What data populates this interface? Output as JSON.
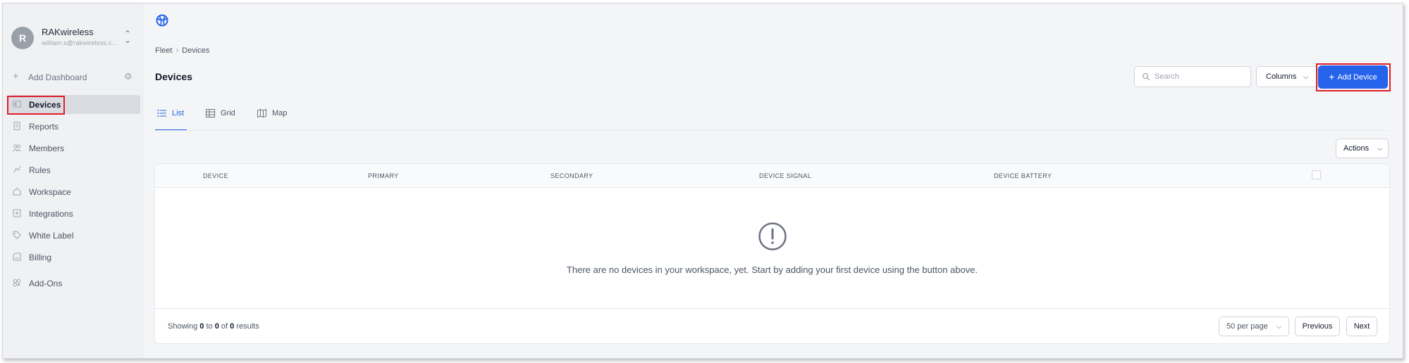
{
  "workspace": {
    "avatar_letter": "R",
    "name": "RAKwireless",
    "email": "william.s@rakwireless.com"
  },
  "sidebar": {
    "add_dashboard": "Add Dashboard",
    "items": [
      {
        "label": "Devices",
        "icon": "devices-icon",
        "active": true
      },
      {
        "label": "Reports",
        "icon": "report-icon"
      },
      {
        "label": "Members",
        "icon": "members-icon"
      },
      {
        "label": "Rules",
        "icon": "rules-icon"
      },
      {
        "label": "Workspace",
        "icon": "workspace-icon"
      },
      {
        "label": "Integrations",
        "icon": "integrations-icon"
      },
      {
        "label": "White Label",
        "icon": "tag-icon"
      },
      {
        "label": "Billing",
        "icon": "billing-icon"
      },
      {
        "label": "Add-Ons",
        "icon": "addons-icon"
      }
    ]
  },
  "breadcrumb": {
    "root": "Fleet",
    "current": "Devices"
  },
  "page": {
    "title": "Devices"
  },
  "toolbar": {
    "search_placeholder": "Search",
    "columns_label": "Columns",
    "add_device_label": "Add Device"
  },
  "tabs": [
    {
      "label": "List",
      "active": true
    },
    {
      "label": "Grid"
    },
    {
      "label": "Map"
    }
  ],
  "actions_label": "Actions",
  "table": {
    "columns": [
      "DEVICE",
      "PRIMARY",
      "SECONDARY",
      "DEVICE SIGNAL",
      "DEVICE BATTERY"
    ],
    "empty_message": "There are no devices in your workspace, yet. Start by adding your first device using the button above."
  },
  "pagination": {
    "showing_prefix": "Showing",
    "from": "0",
    "to_word": "to",
    "to": "0",
    "of_word": "of",
    "total": "0",
    "results_word": "results",
    "per_page": "50 per page",
    "previous": "Previous",
    "next": "Next"
  },
  "colors": {
    "accent": "#2563eb",
    "highlight": "#e11d2a"
  }
}
